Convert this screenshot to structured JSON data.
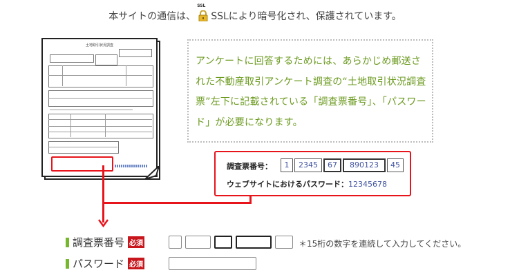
{
  "header": {
    "ssl_notice_pre": "本サイトの通信は、",
    "ssl_badge": "SSL",
    "ssl_notice_post": "SSLにより暗号化され、保護されています。"
  },
  "document": {
    "title": "土地取引状況調査"
  },
  "instruction": {
    "text": "アンケートに回答するためには、あらかじめ郵送された不動産取引アンケート調査の“土地取引状況調査票”左下に記載されている「調査票番号」、「パスワード」が必要になります。"
  },
  "sample": {
    "number_label": "調査票番号：",
    "cells": [
      "1",
      "2345",
      "67",
      "890123",
      "45"
    ],
    "password_label": "ウェブサイトにおけるパスワード：",
    "password_value": "12345678"
  },
  "form": {
    "survey_number_label": "調査票番号",
    "required_badge": "必須",
    "survey_number_note": "＊15桁の数字を連続して入力してください。",
    "password_label": "パスワード",
    "survey_number_fields": [
      "",
      "",
      "",
      "",
      ""
    ],
    "password_value": ""
  },
  "colors": {
    "accent_red": "#e8141c",
    "instruction_green": "#6b9a1f",
    "bar_green": "#77b72d",
    "digit_blue": "#4254a0"
  }
}
